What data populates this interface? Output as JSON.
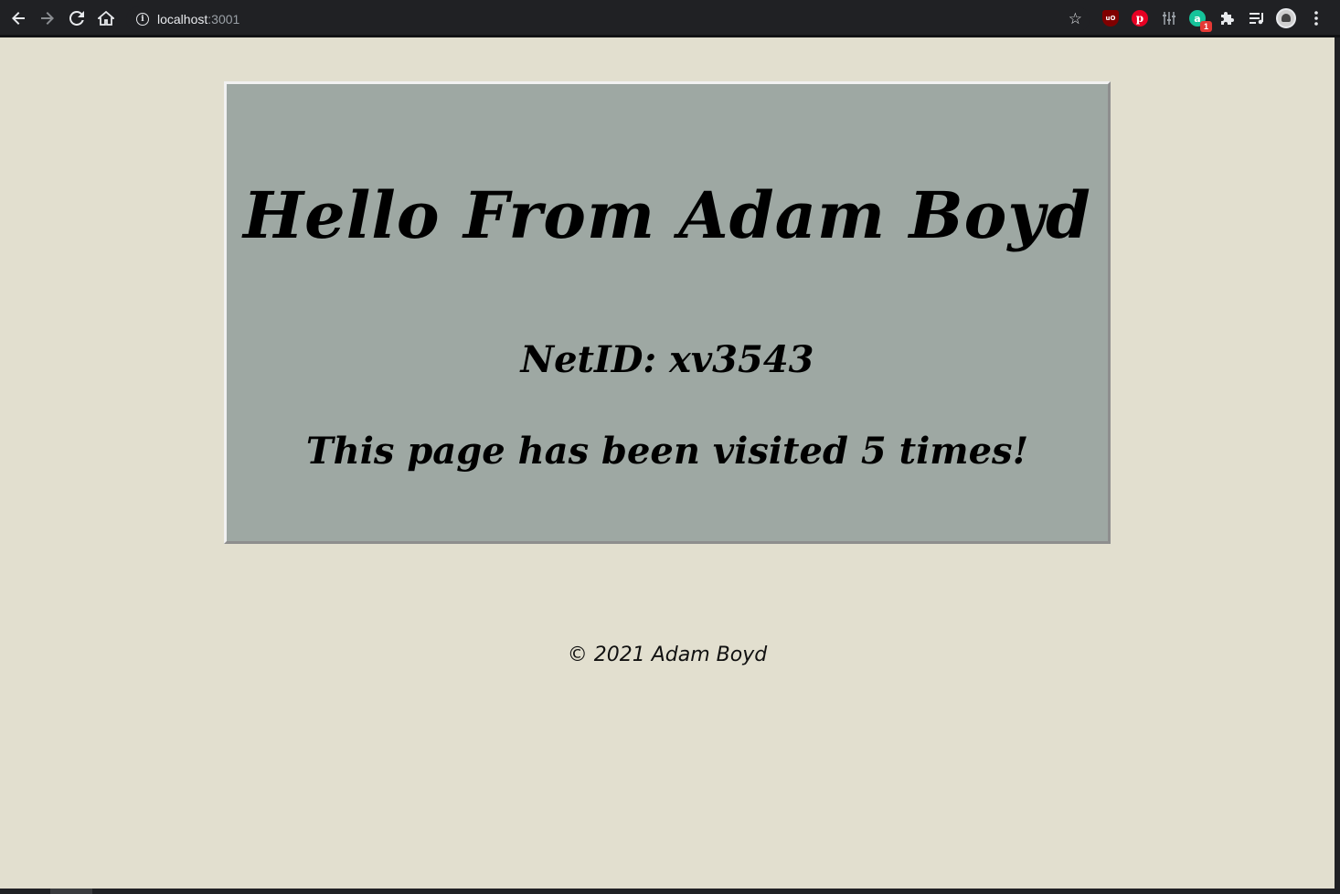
{
  "browser": {
    "url_host": "localhost",
    "url_port": ":3001",
    "icons": {
      "back": "back-arrow-icon",
      "forward": "forward-arrow-icon",
      "reload": "reload-icon",
      "home": "home-icon",
      "info": "info-icon",
      "star": "bookmark-star-icon",
      "extensions": "puzzle-icon",
      "reading_list": "reading-list-icon",
      "menu": "more-menu-icon"
    },
    "extensions": {
      "ublock_label": "uO",
      "pinterest_label": "p",
      "grammarly_label": "a",
      "grammarly_badge": "1"
    }
  },
  "page": {
    "heading": "Hello From Adam Boyd",
    "netid": "NetID: xv3543",
    "visits": "This page has been visited 5 times!",
    "footer": "© 2021 Adam Boyd"
  },
  "colors": {
    "background": "#e2dfcf",
    "card": "#9ea8a3",
    "toolbar": "#202124"
  }
}
